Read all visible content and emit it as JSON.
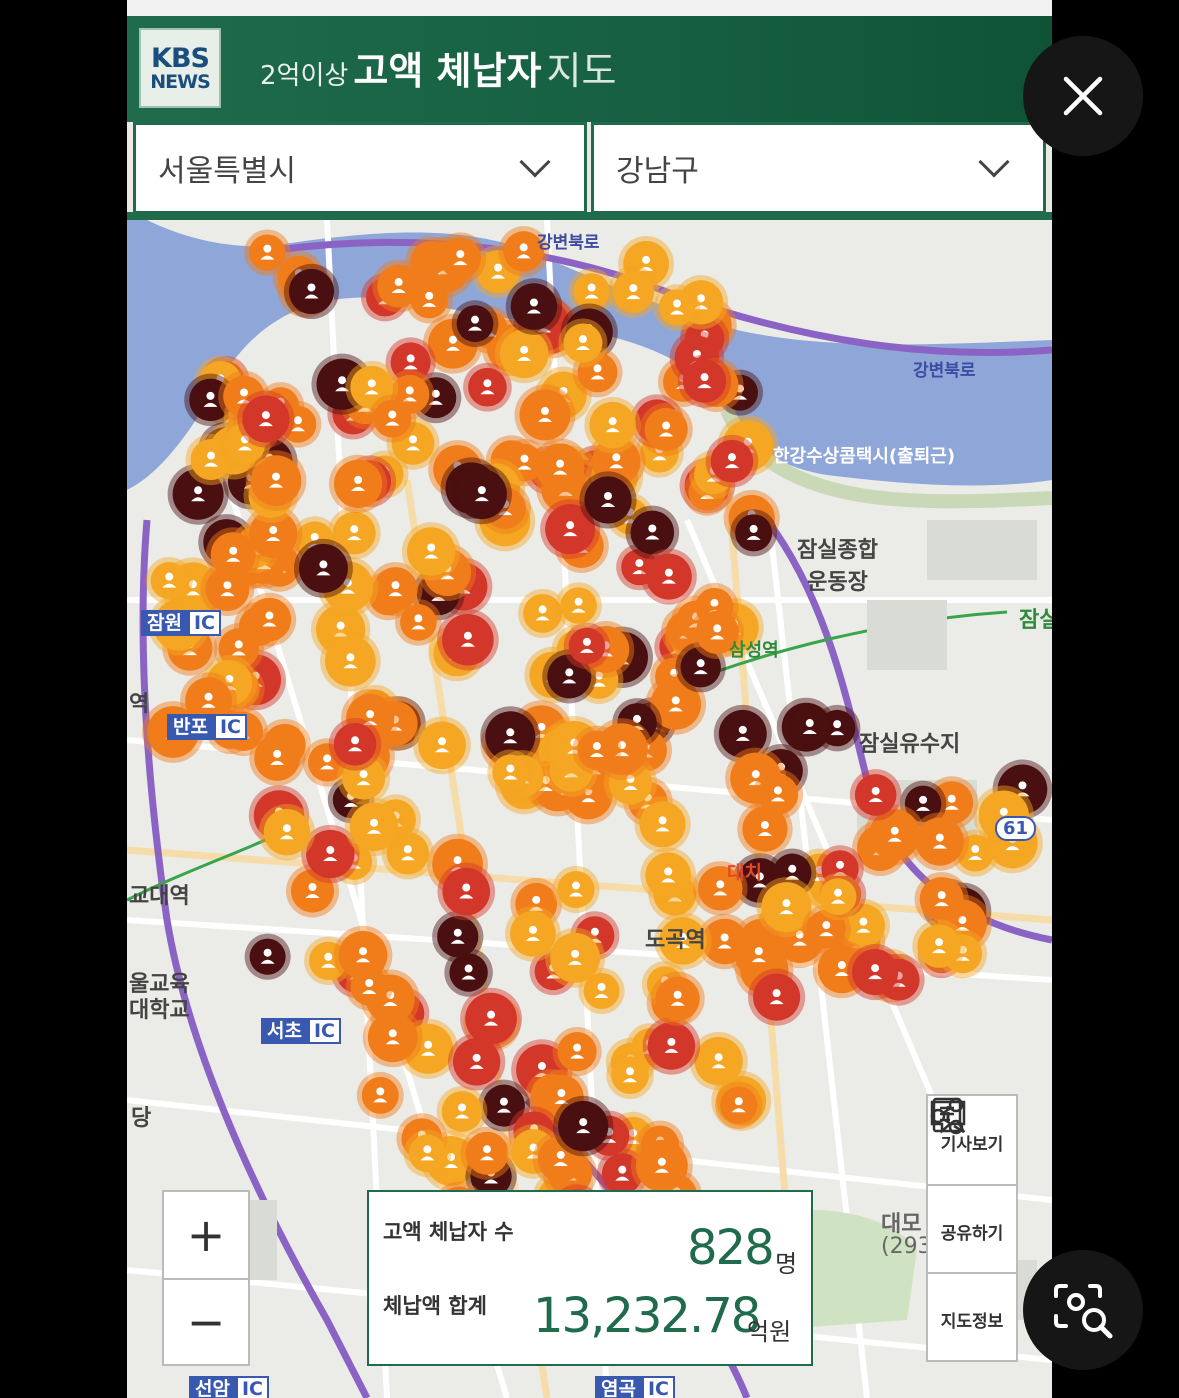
{
  "header": {
    "logo_line1": "KBS",
    "logo_line2": "NEWS",
    "title_prefix": "2억이상",
    "title_main": "고액 체납자",
    "title_suffix": "지도"
  },
  "filters": {
    "city": "서울특별시",
    "district": "강남구"
  },
  "map": {
    "labels": {
      "jamsil_sports": "잠실종합",
      "jamsil_sports2": "운동장",
      "jamsil_station": "잠실",
      "jamsil_reservoir": "잠실유수지",
      "dogok_station": "도곡역",
      "gyodae_station": "교대역",
      "education_univ1": "울교육",
      "education_univ2": "대학교",
      "gangbyeon_north1": "강변북로",
      "gangbyeon_north2": "강변북로",
      "han_river_park": "한강수상콤택시(출퇴근)",
      "samseong_station": "삼성역",
      "daechi": "대치",
      "route_61": "61",
      "daemo": "대모",
      "daemo_height": "(293",
      "dang": "당",
      "yeok": "역"
    },
    "ic_labels": [
      {
        "name": "잠원",
        "code": "IC"
      },
      {
        "name": "반포",
        "code": "IC"
      },
      {
        "name": "서초",
        "code": "IC"
      },
      {
        "name": "선암",
        "code": "IC"
      },
      {
        "name": "염곡",
        "code": "IC"
      }
    ]
  },
  "zoom": {
    "plus": "+",
    "minus": "−"
  },
  "stats": {
    "count_label": "고액 체납자 수",
    "count_value": "828",
    "count_unit": "명",
    "total_label": "체납액 합계",
    "total_value": "13,232.78",
    "total_unit": "억원"
  },
  "side_buttons": {
    "article": "기사보기",
    "share": "공유하기",
    "map_info": "지도정보"
  },
  "icons": {
    "close": "close-icon",
    "lens": "visual-search-icon",
    "article": "document-icon",
    "share": "share-icon",
    "info": "info-icon",
    "marker": "person-marker-icon"
  },
  "colors": {
    "brand_green": "#1f6b4b",
    "marker_light": "#f5a623",
    "marker_orange": "#f07d1a",
    "marker_red": "#d2372a",
    "marker_dark": "#4a0f10",
    "river": "#8fa6d8"
  }
}
